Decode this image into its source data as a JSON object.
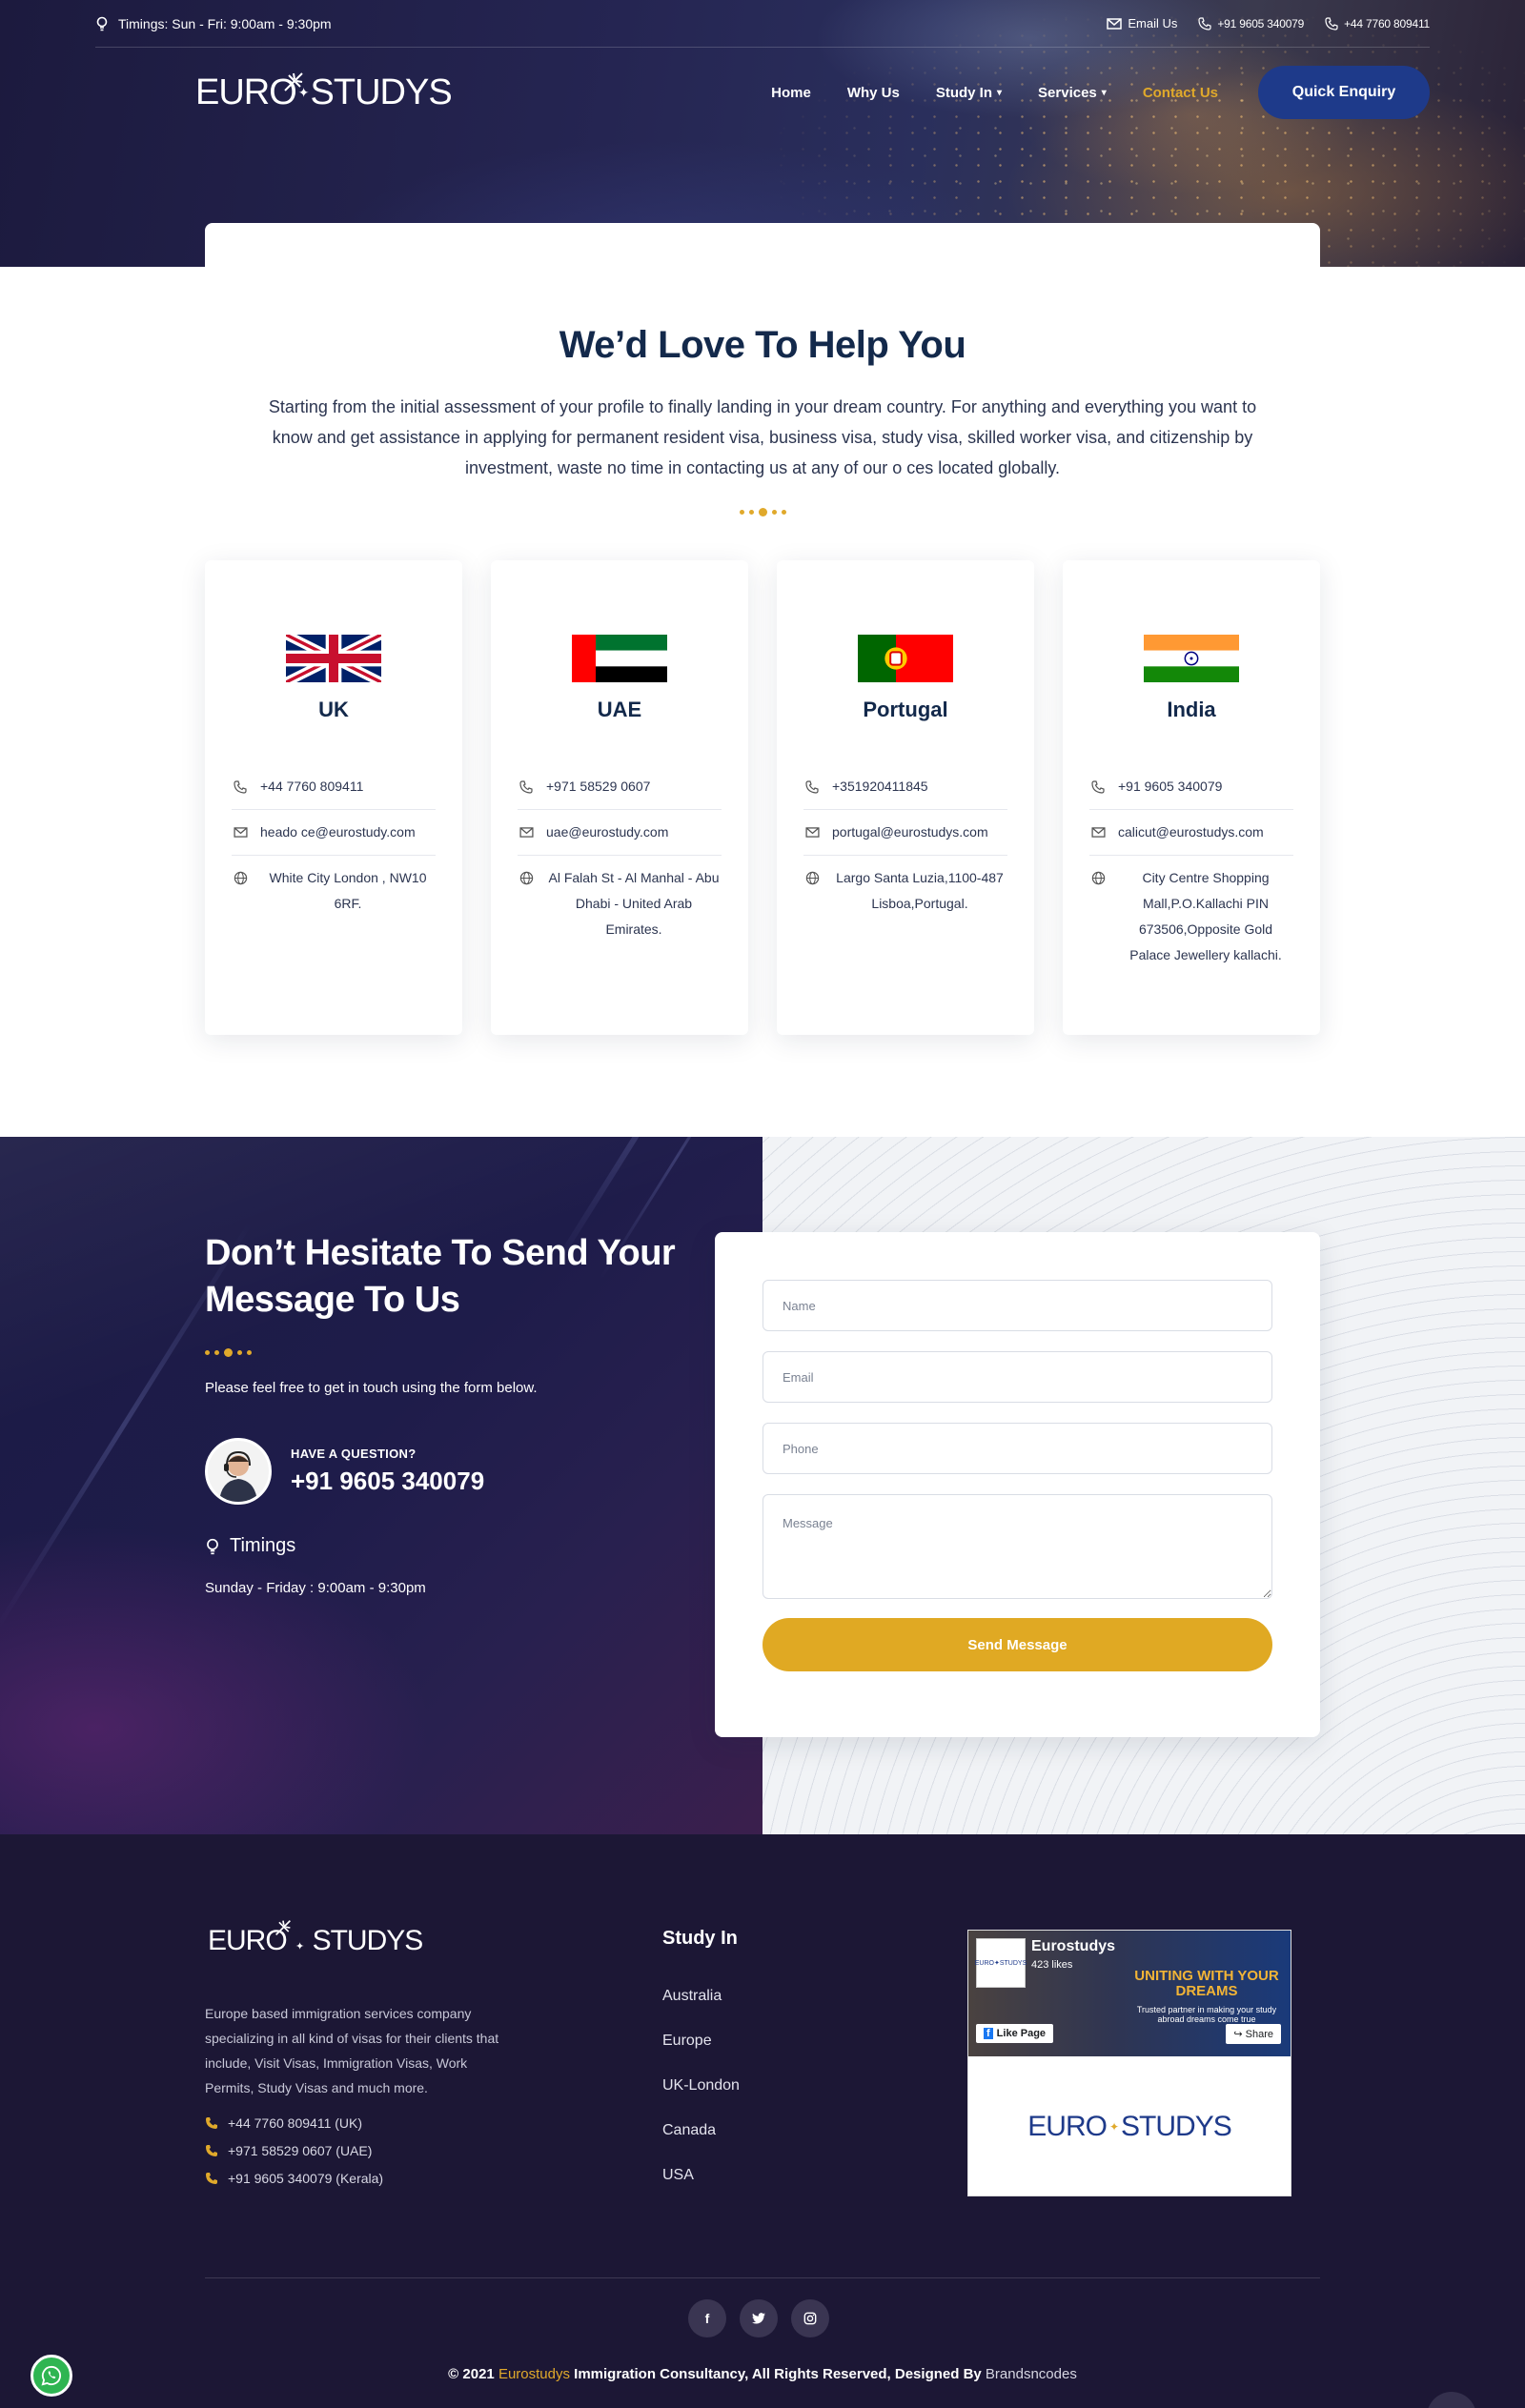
{
  "topbar": {
    "timings": "Timings: Sun - Fri: 9:00am - 9:30pm",
    "email_label": "Email Us",
    "phone_1": "+91 9605 340079",
    "phone_2": "+44 7760 809411"
  },
  "brand": {
    "logo_left": "EURO",
    "logo_right": "STUDYS"
  },
  "nav": {
    "items": [
      {
        "label": "Home"
      },
      {
        "label": "Why Us"
      },
      {
        "label": "Study In"
      },
      {
        "label": "Services"
      },
      {
        "label": "Contact Us"
      }
    ],
    "cta": "Quick Enquiry"
  },
  "help": {
    "title": "We’d Love To Help You",
    "text": "Starting from the initial assessment of your profile to finally landing in your dream country. For anything and everything you want to know and get assistance in applying for permanent resident visa, business visa, study visa, skilled worker visa, and citizenship by investment, waste no time in contacting us at any of our o     ces located globally."
  },
  "offices": [
    {
      "country": "UK",
      "phone": "+44 7760 809411",
      "email": "heado     ce@eurostudy.com",
      "address": "White City London , NW10 6RF."
    },
    {
      "country": "UAE",
      "phone": "+971 58529 0607",
      "email": "uae@eurostudy.com",
      "address": "Al Falah St - Al Manhal - Abu Dhabi - United Arab Emirates."
    },
    {
      "country": "Portugal",
      "phone": "+351920411845",
      "email": "portugal@eurostudys.com",
      "address": "Largo Santa Luzia,1100-487 Lisboa,Portugal."
    },
    {
      "country": "India",
      "phone": "+91 9605 340079",
      "email": "calicut@eurostudys.com",
      "address": "City Centre Shopping Mall,P.O.Kallachi PIN 673506,Opposite Gold Palace Jewellery kallachi."
    }
  ],
  "contact": {
    "title": "Don’t Hesitate To Send Your Message To Us",
    "lead": "Please feel free to get in touch using the form below.",
    "question_label": "HAVE A QUESTION?",
    "question_phone": "+91 9605 340079",
    "timings_title": "Timings",
    "timings_value": "Sunday - Friday : 9:00am - 9:30pm"
  },
  "form": {
    "name_placeholder": "Name",
    "email_placeholder": "Email",
    "phone_placeholder": "Phone",
    "message_placeholder": "Message",
    "submit_label": "Send Message"
  },
  "footer": {
    "about": "Europe based immigration services company specializing in all kind of visas for their clients that include, Visit Visas, Immigration Visas, Work Permits, Study Visas and much more.",
    "phones": [
      "+44 7760 809411 (UK)",
      "+971 58529 0607 (UAE)",
      "+91 9605 340079 (Kerala)"
    ],
    "study_in_title": "Study In",
    "study_in": [
      "Australia",
      "Europe",
      "UK-London",
      "Canada",
      "USA"
    ],
    "fb": {
      "name": "Eurostudys",
      "likes": "423 likes",
      "tagline": "UNITING WITH YOUR DREAMS",
      "sub": "Trusted partner in making your study abroad dreams come true",
      "like_btn": "Like Page",
      "share_btn": "Share"
    },
    "social": [
      "f",
      "t",
      "ig"
    ],
    "copyright_prefix": "© 2021",
    "copyright_brand": "Eurostudys",
    "copyright_mid": "Immigration Consultancy, All Rights Reserved, Designed By",
    "copyright_designer": "Brandsncodes"
  },
  "colors": {
    "accent": "#e0a92b",
    "primary_navy": "#13294b",
    "cta_blue": "#1e3a8a",
    "footer_bg": "#1c1735"
  }
}
